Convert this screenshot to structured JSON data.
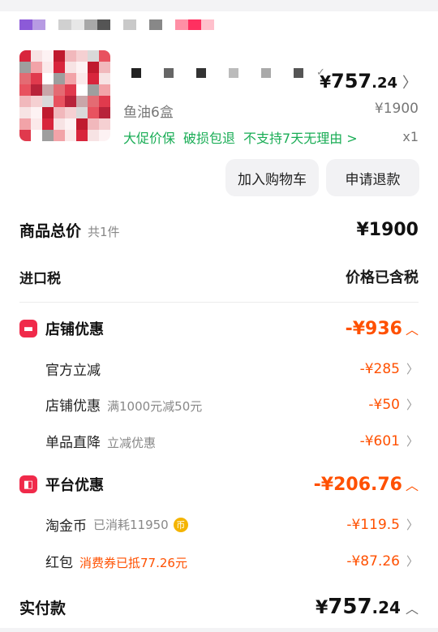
{
  "product": {
    "price_yen": "¥",
    "price_int": "757",
    "price_dec": ".24",
    "spec": "鱼油6盒",
    "original_price": "¥1900",
    "tags": [
      "大促价保",
      "破损包退",
      "不支持7天无理由 >"
    ],
    "quantity": "x1",
    "buttons": {
      "add_to_cart": "加入购物车",
      "refund": "申请退款"
    }
  },
  "summary": {
    "total_label": "商品总价",
    "total_count": "共1件",
    "total_value": "¥1900",
    "tax_label": "进口税",
    "tax_value": "价格已含税"
  },
  "store_discount": {
    "icon": "store-icon",
    "title": "店铺优惠",
    "total": "-¥936",
    "items": [
      {
        "label": "官方立减",
        "note": "",
        "value": "-¥285"
      },
      {
        "label": "店铺优惠",
        "note": "满1000元减50元",
        "value": "-¥50"
      },
      {
        "label": "单品直降",
        "note": "立减优惠",
        "value": "-¥601"
      }
    ]
  },
  "platform_discount": {
    "icon": "platform-coupon-icon",
    "title": "平台优惠",
    "total": "-¥206.76",
    "items": [
      {
        "label": "淘金币",
        "note": "已消耗11950",
        "value": "-¥119.5"
      },
      {
        "label": "红包",
        "note": "消费券已抵77.26元",
        "value": "-¥87.26"
      }
    ]
  },
  "final": {
    "label": "实付款",
    "yen": "¥",
    "int": "757",
    "dec": ".24"
  },
  "colors": {
    "accent_orange": "#ff5000",
    "tag_green": "#1aad56",
    "badge_red": "#f02a4a"
  }
}
